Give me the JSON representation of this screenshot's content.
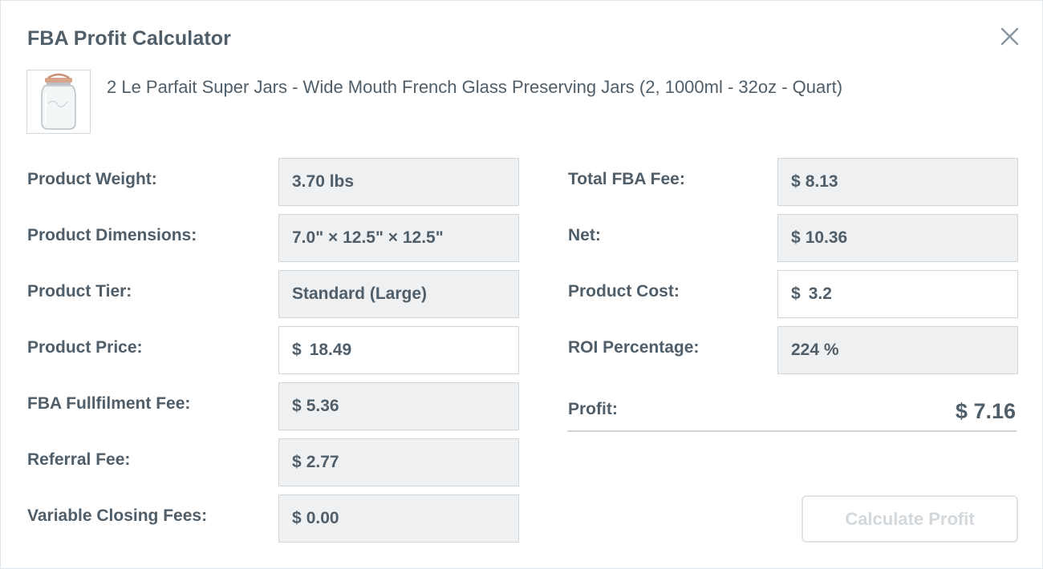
{
  "dialog": {
    "title": "FBA Profit Calculator",
    "close_icon": "close-icon"
  },
  "product": {
    "thumbnail_icon": "glass-jar-image",
    "title": "2 Le Parfait Super Jars - Wide Mouth French Glass Preserving Jars (2, 1000ml - 32oz - Quart)"
  },
  "left": {
    "weight": {
      "label": "Product Weight:",
      "value": "3.70 lbs"
    },
    "dimensions": {
      "label": "Product Dimensions:",
      "value": "7.0\" × 12.5\" × 12.5\""
    },
    "tier": {
      "label": "Product Tier:",
      "value": "Standard (Large)"
    },
    "price": {
      "label": "Product Price:",
      "currency": "$",
      "value": "18.49"
    },
    "fulfilment_fee": {
      "label": "FBA Fullfilment Fee:",
      "currency": "$",
      "value": "5.36"
    },
    "referral_fee": {
      "label": "Referral Fee:",
      "currency": "$",
      "value": "2.77"
    },
    "closing_fees": {
      "label": "Variable Closing Fees:",
      "currency": "$",
      "value": "0.00"
    }
  },
  "right": {
    "total_fee": {
      "label": "Total FBA Fee:",
      "currency": "$",
      "value": "8.13"
    },
    "net": {
      "label": "Net:",
      "currency": "$",
      "value": "10.36"
    },
    "cost": {
      "label": "Product Cost:",
      "currency": "$",
      "value": "3.2"
    },
    "roi": {
      "label": "ROI Percentage:",
      "value": "224 %"
    },
    "profit": {
      "label": "Profit:",
      "value": "$ 7.16"
    }
  },
  "actions": {
    "calculate_label": "Calculate Profit"
  },
  "colors": {
    "text": "#4f5e69",
    "readonly_bg": "#eef0f2",
    "border": "#cfd5d9",
    "disabled_text": "#d3d8dc"
  }
}
